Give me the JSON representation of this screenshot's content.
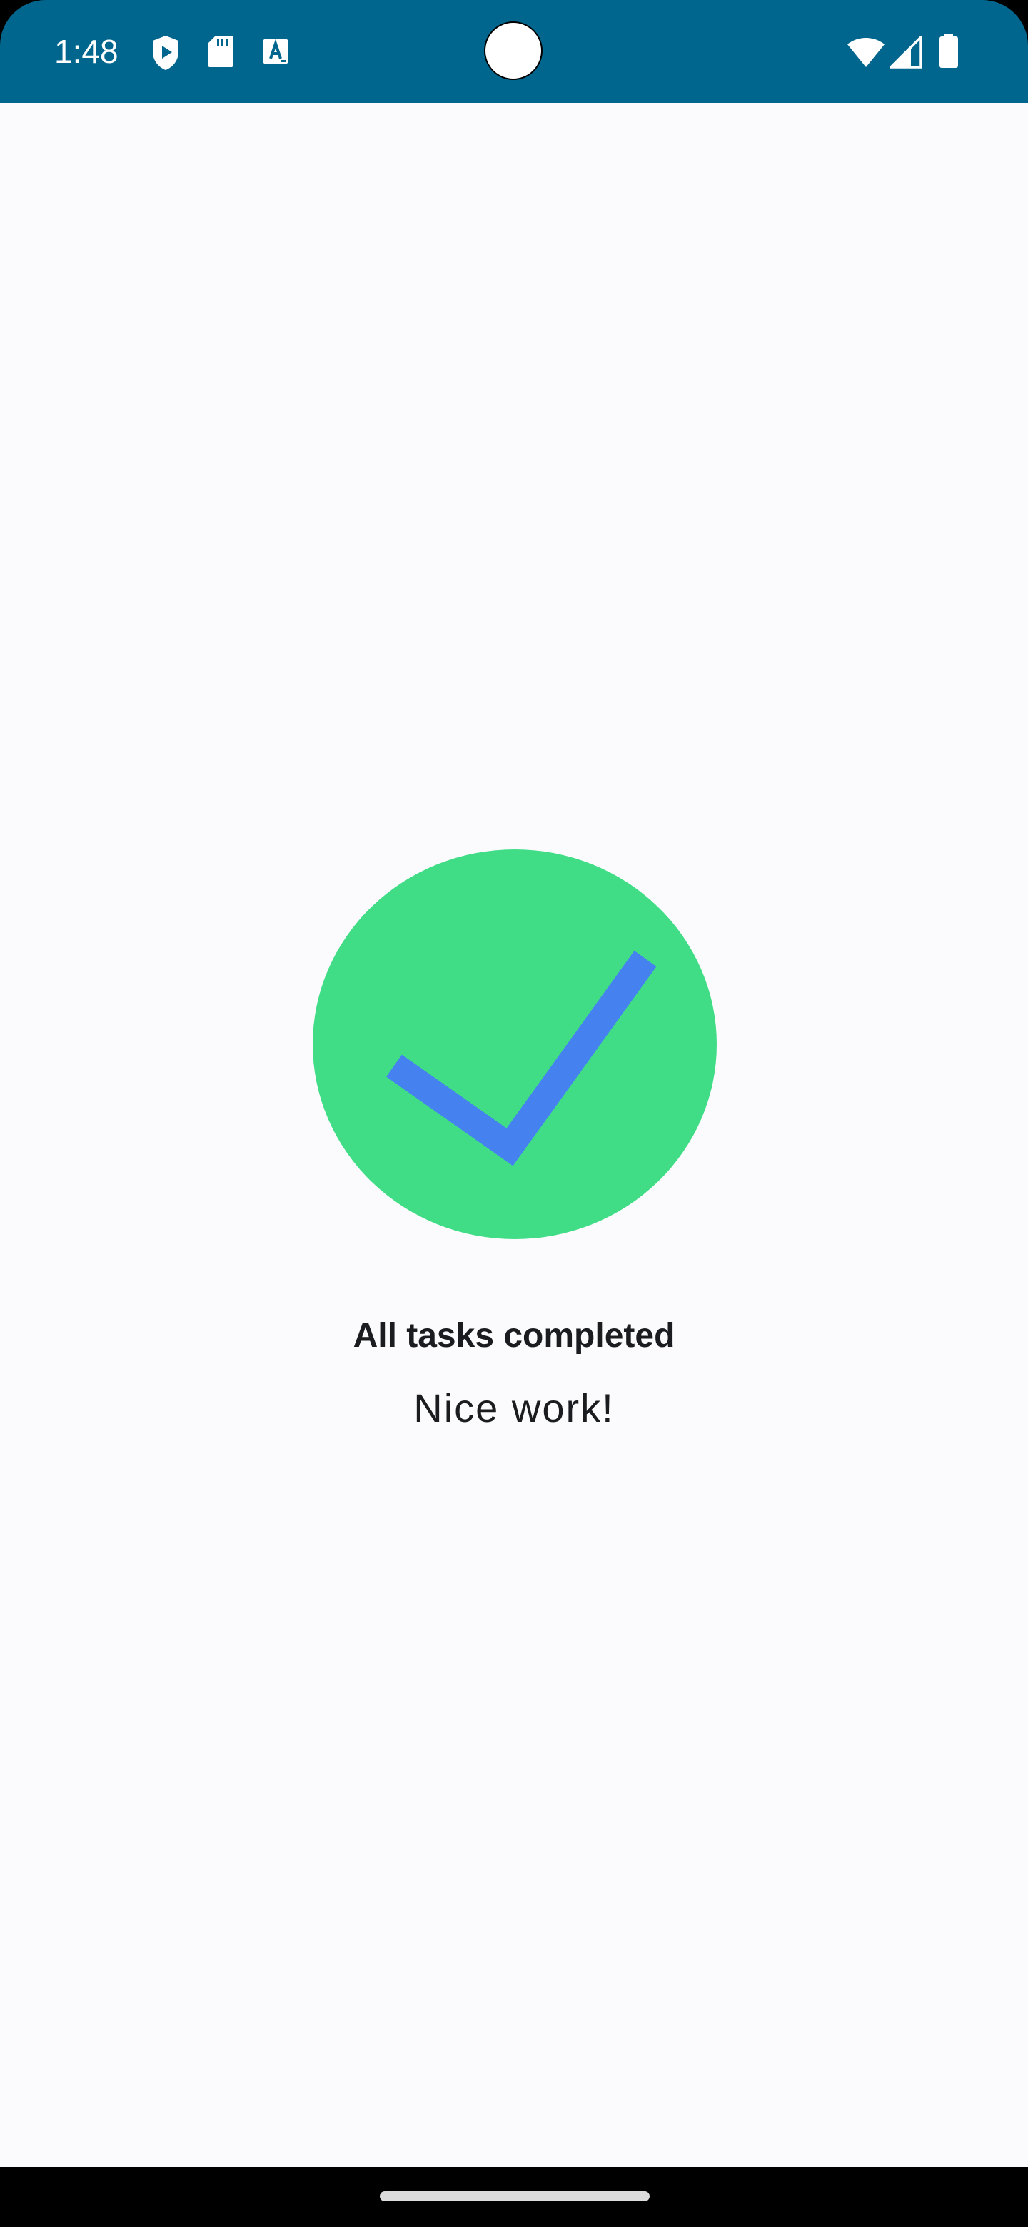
{
  "status_bar": {
    "time": "1:48",
    "background_color": "#00668E",
    "left_icons": [
      "play-protect-icon",
      "sd-card-icon",
      "text-a-icon"
    ],
    "right_icons": [
      "wifi-icon",
      "cellular-signal-icon",
      "battery-icon"
    ]
  },
  "main": {
    "illustration": {
      "icon": "checkmark-circle-icon",
      "circle_color": "#41DD86",
      "check_color": "#4582F0"
    },
    "title": "All tasks completed",
    "subtitle": "Nice work!"
  },
  "nav_bar": {
    "handle": "home-gesture-handle"
  }
}
